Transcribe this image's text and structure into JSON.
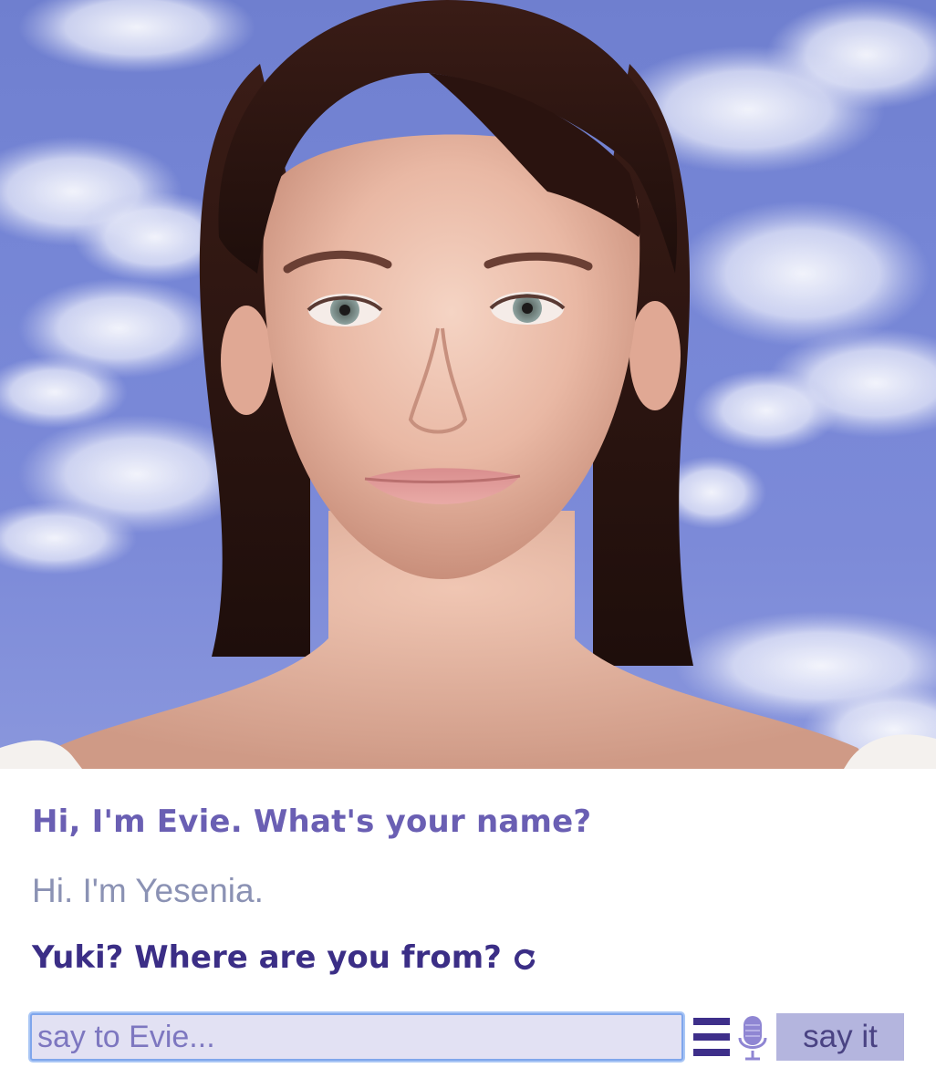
{
  "chat": {
    "bot_greeting": "Hi, I'm Evie. What's your name?",
    "user_reply": "Hi. I'm Yesenia.",
    "bot_followup": "Yuki? Where are you from?"
  },
  "input": {
    "placeholder": "say to Evie...",
    "value": ""
  },
  "controls": {
    "submit_label": "say it",
    "menu_icon": "hamburger-menu-icon",
    "mic_icon": "microphone-icon",
    "refresh_icon": "refresh-icon"
  },
  "colors": {
    "bot_text_light": "#6a5fb3",
    "bot_text_dark": "#3b2e86",
    "user_text": "#8b92b4",
    "sky": "#7686d6",
    "button_bg": "#b4b5de",
    "input_bg": "#e2e1f3"
  }
}
